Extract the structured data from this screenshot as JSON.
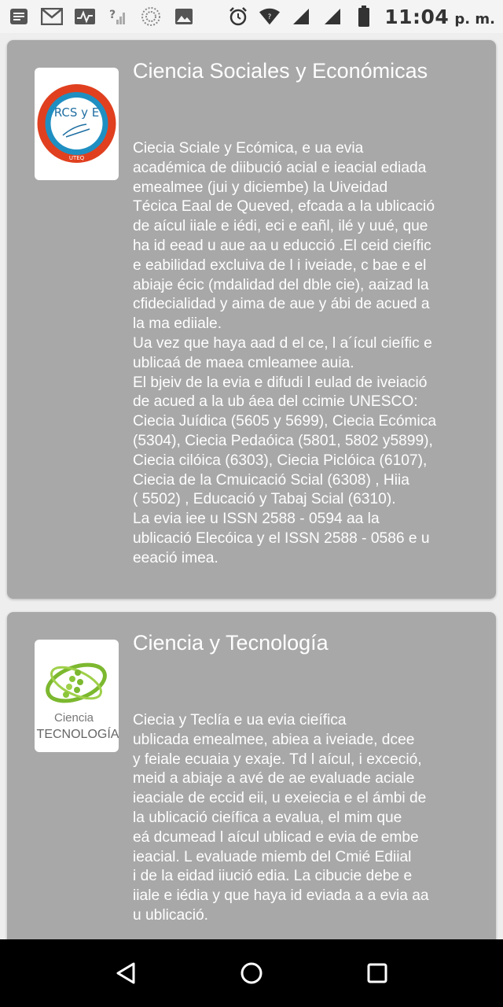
{
  "status_bar": {
    "time": "11:04",
    "ampm": "p. m.",
    "left_icons": [
      "notes-icon",
      "gmail-icon",
      "activity-icon",
      "no-signal-icon",
      "sync-icon",
      "image-icon"
    ],
    "right_icons": [
      "alarm-icon",
      "wifi-icon",
      "signal-icon",
      "signal-icon-2",
      "battery-icon"
    ]
  },
  "cards": [
    {
      "title": "Ciencia Sociales y Económicas",
      "logo_text_main": "RCS y E",
      "logo_text_ring": "REVISTA DE CIENCIAS SOCIALES Y ECONÓMICAS",
      "logo_text_sub": "UTEQ",
      "body": "Ciecia Sciale y Ecómica, e ua evia\nacadémica de diibució acial e ieacial ediada\nemealmee (jui y diciembe)  la Uiveidad\nTécica Eaal de Queved, efcada a la ublicació\nde aícul iiale e iédi, eci e eañl, ilé y uué, que\nha id eead  u aue aa u educció .El ceid cieífic\ne eabilidad excluiva de l i iveiade, c bae e el\nabiaje écic (mdalidad del dble cie), aaizad la\ncfidecialidad y aima de aue y ábi de acued a\nla ma ediiale.\nUa vez que haya aad d el ce, l a´ícul cieífic e\nublicaá de maea cmleamee auia.\nEl bjeiv de la evia e difudi l eulad de iveiació\nde acued a la ub áea del ccimie UNESCO:\nCiecia Juídica (5605 y 5699), Ciecia Ecómica\n(5304), Ciecia Pedaóica (5801, 5802 y5899),\nCiecia cilóica (6303), Ciecia Piclóica (6107),\nCiecia de la Cmuicació Scial (6308) , Hiia\n( 5502) , Educació y Tabaj Scial (6310).\nLa evia iee u ISSN 2588 - 0594 aa la\nublicació Elecóica y el ISSN 2588 - 0586 e u\neeació imea."
    },
    {
      "title": "Ciencia y Tecnología",
      "logo_text_top": "Ciencia",
      "logo_text_bottom": "TECNOLOGÍA",
      "body": "Ciecia y Teclía e ua evia cieífica\nublicada emealmee, abiea a iveiade, dcee\ny feiale ecuaia y exaje. Td l aícul, i exceció,\nmeid a abiaje a avé de ae evaluade aciale\nieaciale de eccid eii,  u exeiecia e el ámbi de\nla ublicació cieífica a evalua, el mim que\neá dcumead  l aícul ublicad e evia de embe\nieacial. L evaluade   miemb del Cmié Ediial\ni de la eidad  iiució edia. La cibucie debe e\niiale e iédia y que  haya id eviada a a evia aa\nu ublicació."
    }
  ],
  "nav_bar": {
    "buttons": [
      "back-icon",
      "home-icon",
      "recents-icon"
    ]
  }
}
